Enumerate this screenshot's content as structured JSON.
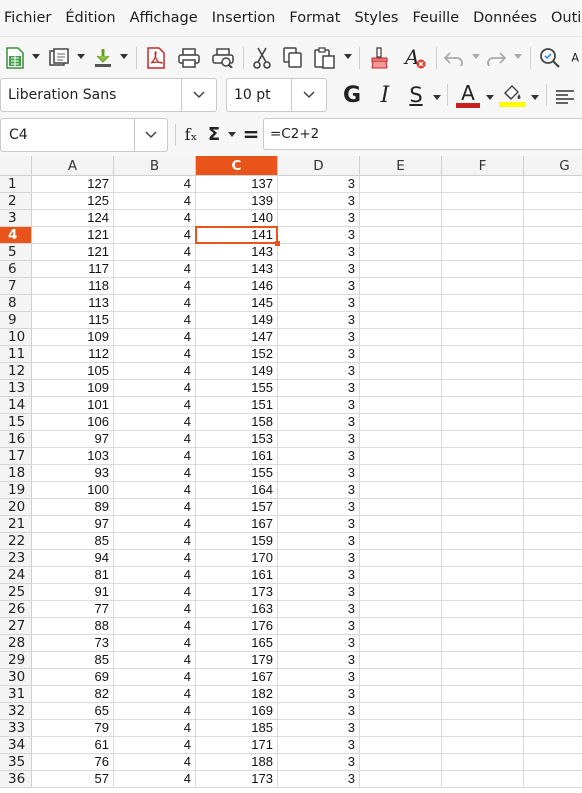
{
  "menu": [
    "Fichier",
    "Édition",
    "Affichage",
    "Insertion",
    "Format",
    "Styles",
    "Feuille",
    "Données",
    "Outils"
  ],
  "toolbar": {
    "icons": [
      "new-document-icon",
      "templates-icon",
      "save-icon",
      "export-pdf-icon",
      "print-icon",
      "print-preview-icon",
      "cut-icon",
      "copy-icon",
      "paste-icon",
      "clone-formatting-icon",
      "clear-formatting-icon",
      "undo-icon",
      "redo-icon",
      "find-replace-icon",
      "spelling-icon"
    ]
  },
  "formatting": {
    "font_name": "Liberation Sans",
    "font_size": "10 pt",
    "bold_label": "G",
    "italic_label": "I",
    "underline_label": "S",
    "font_color_label": "A",
    "font_color": "#c9211e",
    "highlight_color": "#ffff00"
  },
  "formula_bar": {
    "cell_ref": "C4",
    "function_wizard_label": "fₓ",
    "sum_label": "Σ",
    "equals_label": "=",
    "formula": "=C2+2"
  },
  "sheet": {
    "columns": [
      "A",
      "B",
      "C",
      "D",
      "E",
      "F",
      "G"
    ],
    "selected_column": "C",
    "selected_row": 4,
    "rows": [
      {
        "n": "1",
        "a": "127",
        "b": "4",
        "c": "137",
        "d": "3"
      },
      {
        "n": "2",
        "a": "125",
        "b": "4",
        "c": "139",
        "d": "3"
      },
      {
        "n": "3",
        "a": "124",
        "b": "4",
        "c": "140",
        "d": "3"
      },
      {
        "n": "4",
        "a": "121",
        "b": "4",
        "c": "141",
        "d": "3"
      },
      {
        "n": "5",
        "a": "121",
        "b": "4",
        "c": "143",
        "d": "3"
      },
      {
        "n": "6",
        "a": "117",
        "b": "4",
        "c": "143",
        "d": "3"
      },
      {
        "n": "7",
        "a": "118",
        "b": "4",
        "c": "146",
        "d": "3"
      },
      {
        "n": "8",
        "a": "113",
        "b": "4",
        "c": "145",
        "d": "3"
      },
      {
        "n": "9",
        "a": "115",
        "b": "4",
        "c": "149",
        "d": "3"
      },
      {
        "n": "10",
        "a": "109",
        "b": "4",
        "c": "147",
        "d": "3"
      },
      {
        "n": "11",
        "a": "112",
        "b": "4",
        "c": "152",
        "d": "3"
      },
      {
        "n": "12",
        "a": "105",
        "b": "4",
        "c": "149",
        "d": "3"
      },
      {
        "n": "13",
        "a": "109",
        "b": "4",
        "c": "155",
        "d": "3"
      },
      {
        "n": "14",
        "a": "101",
        "b": "4",
        "c": "151",
        "d": "3"
      },
      {
        "n": "15",
        "a": "106",
        "b": "4",
        "c": "158",
        "d": "3"
      },
      {
        "n": "16",
        "a": "97",
        "b": "4",
        "c": "153",
        "d": "3"
      },
      {
        "n": "17",
        "a": "103",
        "b": "4",
        "c": "161",
        "d": "3"
      },
      {
        "n": "18",
        "a": "93",
        "b": "4",
        "c": "155",
        "d": "3"
      },
      {
        "n": "19",
        "a": "100",
        "b": "4",
        "c": "164",
        "d": "3"
      },
      {
        "n": "20",
        "a": "89",
        "b": "4",
        "c": "157",
        "d": "3"
      },
      {
        "n": "21",
        "a": "97",
        "b": "4",
        "c": "167",
        "d": "3"
      },
      {
        "n": "22",
        "a": "85",
        "b": "4",
        "c": "159",
        "d": "3"
      },
      {
        "n": "23",
        "a": "94",
        "b": "4",
        "c": "170",
        "d": "3"
      },
      {
        "n": "24",
        "a": "81",
        "b": "4",
        "c": "161",
        "d": "3"
      },
      {
        "n": "25",
        "a": "91",
        "b": "4",
        "c": "173",
        "d": "3"
      },
      {
        "n": "26",
        "a": "77",
        "b": "4",
        "c": "163",
        "d": "3"
      },
      {
        "n": "27",
        "a": "88",
        "b": "4",
        "c": "176",
        "d": "3"
      },
      {
        "n": "28",
        "a": "73",
        "b": "4",
        "c": "165",
        "d": "3"
      },
      {
        "n": "29",
        "a": "85",
        "b": "4",
        "c": "179",
        "d": "3"
      },
      {
        "n": "30",
        "a": "69",
        "b": "4",
        "c": "167",
        "d": "3"
      },
      {
        "n": "31",
        "a": "82",
        "b": "4",
        "c": "182",
        "d": "3"
      },
      {
        "n": "32",
        "a": "65",
        "b": "4",
        "c": "169",
        "d": "3"
      },
      {
        "n": "33",
        "a": "79",
        "b": "4",
        "c": "185",
        "d": "3"
      },
      {
        "n": "34",
        "a": "61",
        "b": "4",
        "c": "171",
        "d": "3"
      },
      {
        "n": "35",
        "a": "76",
        "b": "4",
        "c": "188",
        "d": "3"
      },
      {
        "n": "36",
        "a": "57",
        "b": "4",
        "c": "173",
        "d": "3"
      }
    ]
  }
}
